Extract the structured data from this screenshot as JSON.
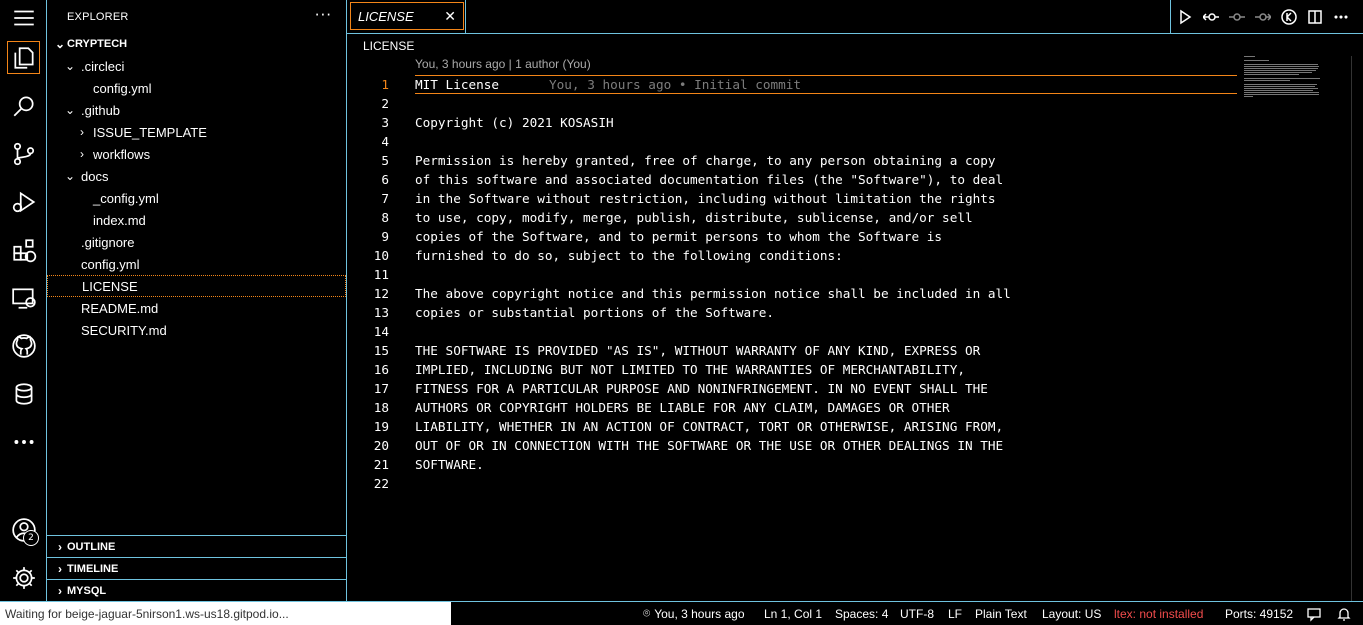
{
  "explorer": {
    "title": "EXPLORER",
    "more": "···",
    "root": "CRYPTECH",
    "tree": [
      {
        "label": ".circleci",
        "depth": 1,
        "type": "folder-open"
      },
      {
        "label": "config.yml",
        "depth": 2,
        "type": "file"
      },
      {
        "label": ".github",
        "depth": 1,
        "type": "folder-open"
      },
      {
        "label": "ISSUE_TEMPLATE",
        "depth": 2,
        "type": "folder-closed"
      },
      {
        "label": "workflows",
        "depth": 2,
        "type": "folder-closed"
      },
      {
        "label": "docs",
        "depth": 1,
        "type": "folder-open"
      },
      {
        "label": "_config.yml",
        "depth": 2,
        "type": "file"
      },
      {
        "label": "index.md",
        "depth": 2,
        "type": "file"
      },
      {
        "label": ".gitignore",
        "depth": 1,
        "type": "file"
      },
      {
        "label": "config.yml",
        "depth": 1,
        "type": "file"
      },
      {
        "label": "LICENSE",
        "depth": 1,
        "type": "file",
        "selected": true
      },
      {
        "label": "README.md",
        "depth": 1,
        "type": "file"
      },
      {
        "label": "SECURITY.md",
        "depth": 1,
        "type": "file"
      }
    ],
    "sections": [
      "OUTLINE",
      "TIMELINE",
      "MYSQL"
    ]
  },
  "activity": {
    "accounts_badge": "2",
    "icons": [
      "explorer-icon",
      "search-icon",
      "source-control-icon",
      "run-debug-icon",
      "extensions-icon",
      "remote-explorer-icon",
      "github-icon",
      "database-icon",
      "more-icon",
      "accounts-icon",
      "settings-gear-icon"
    ]
  },
  "editor": {
    "tab_label": "LICENSE",
    "tab_close": "✕",
    "breadcrumb": "LICENSE",
    "blame_header": "You, 3 hours ago | 1 author (You)",
    "inline_blame": "You, 3 hours ago • Initial commit",
    "lines": [
      "MIT License",
      "",
      "Copyright (c) 2021 KOSASIH",
      "",
      "Permission is hereby granted, free of charge, to any person obtaining a copy",
      "of this software and associated documentation files (the \"Software\"), to deal",
      "in the Software without restriction, including without limitation the rights",
      "to use, copy, modify, merge, publish, distribute, sublicense, and/or sell",
      "copies of the Software, and to permit persons to whom the Software is",
      "furnished to do so, subject to the following conditions:",
      "",
      "The above copyright notice and this permission notice shall be included in all",
      "copies or substantial portions of the Software.",
      "",
      "THE SOFTWARE IS PROVIDED \"AS IS\", WITHOUT WARRANTY OF ANY KIND, EXPRESS OR",
      "IMPLIED, INCLUDING BUT NOT LIMITED TO THE WARRANTIES OF MERCHANTABILITY,",
      "FITNESS FOR A PARTICULAR PURPOSE AND NONINFRINGEMENT. IN NO EVENT SHALL THE",
      "AUTHORS OR COPYRIGHT HOLDERS BE LIABLE FOR ANY CLAIM, DAMAGES OR OTHER",
      "LIABILITY, WHETHER IN AN ACTION OF CONTRACT, TORT OR OTHERWISE, ARISING FROM,",
      "OUT OF OR IN CONNECTION WITH THE SOFTWARE OR THE USE OR OTHER DEALINGS IN THE",
      "SOFTWARE.",
      ""
    ],
    "current_line": 1
  },
  "statusbar": {
    "remote": "Waiting for beige-jaguar-5nirson1.ws-us18.gitpod.io...",
    "blame": "You, 3 hours ago",
    "position": "Ln 1, Col 1",
    "spaces": "Spaces: 4",
    "encoding": "UTF-8",
    "eol": "LF",
    "language": "Plain Text",
    "layout": "Layout: US",
    "ltex": "ltex: not installed",
    "ports": "Ports: 49152"
  },
  "colors": {
    "border": "#6fc3df",
    "focus": "#f38518",
    "error": "#f14c4c"
  }
}
